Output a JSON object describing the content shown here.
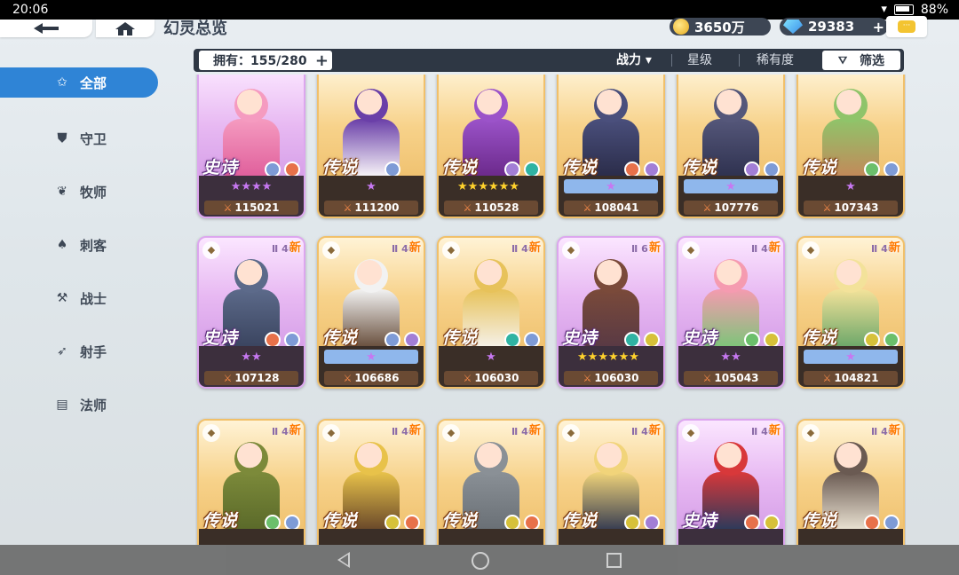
{
  "status_bar": {
    "time": "20:06",
    "battery": "88%"
  },
  "header": {
    "title": "幻灵总览",
    "gold": "3650万",
    "gems": "29383",
    "gem_plus": "+"
  },
  "sidebar": {
    "items": [
      {
        "label": "全部",
        "icon": "star-outline-icon"
      },
      {
        "label": "守卫",
        "icon": "shield-icon"
      },
      {
        "label": "牧师",
        "icon": "wings-icon"
      },
      {
        "label": "刺客",
        "icon": "hood-icon"
      },
      {
        "label": "战士",
        "icon": "axe-icon"
      },
      {
        "label": "射手",
        "icon": "bow-icon"
      },
      {
        "label": "法师",
        "icon": "book-icon"
      }
    ]
  },
  "toolbar": {
    "owned": "拥有：155/280",
    "sort_power": "战力 ▾",
    "sort_star": "星级",
    "sort_rarity": "稀有度",
    "filter": "筛选"
  },
  "cards": [
    {
      "rarity": "史诗",
      "type": "epic",
      "stars": "★★★★",
      "star_style": "purple",
      "power": "115021",
      "is_new": false,
      "level": "",
      "c1": "#f59bc0",
      "c2": "#e0609c",
      "elem1": "#7e9bd6",
      "elem2": "#e7714a"
    },
    {
      "rarity": "传说",
      "type": "legend",
      "stars": "★",
      "star_style": "purple",
      "power": "111200",
      "is_new": false,
      "level": "",
      "c1": "#6a3fa8",
      "c2": "#f6f2f7",
      "elem1": "#7e9bd6",
      "elem2": ""
    },
    {
      "rarity": "传说",
      "type": "legend",
      "stars": "★★★★★★",
      "star_style": "gold",
      "power": "110528",
      "is_new": false,
      "level": "",
      "c1": "#9b53c9",
      "c2": "#6c2a8c",
      "elem1": "#a27ed6",
      "elem2": "#2fb3a3"
    },
    {
      "rarity": "传说",
      "type": "legend",
      "stars": "★",
      "star_style": "blue-bar",
      "power": "108041",
      "is_new": false,
      "level": "",
      "c1": "#4a4f7c",
      "c2": "#2b2d4a",
      "elem1": "#e7714a",
      "elem2": "#a27ed6"
    },
    {
      "rarity": "传说",
      "type": "legend",
      "stars": "★",
      "star_style": "blue-bar",
      "power": "107776",
      "is_new": false,
      "level": "",
      "c1": "#55577a",
      "c2": "#2f3250",
      "elem1": "#a27ed6",
      "elem2": "#7e9bd6"
    },
    {
      "rarity": "传说",
      "type": "legend",
      "stars": "★",
      "star_style": "purple",
      "power": "107343",
      "is_new": false,
      "level": "",
      "c1": "#8fc46a",
      "c2": "#c28a5a",
      "elem1": "#6bbf6b",
      "elem2": "#7e9bd6"
    },
    {
      "rarity": "史诗",
      "type": "epic",
      "stars": "★★",
      "star_style": "purple",
      "power": "107128",
      "is_new": true,
      "level": "46",
      "c1": "#5c6a8a",
      "c2": "#3b4560",
      "elem1": "#e7714a",
      "elem2": "#7e9bd6"
    },
    {
      "rarity": "传说",
      "type": "legend",
      "stars": "★",
      "star_style": "blue-bar",
      "power": "106686",
      "is_new": true,
      "level": "46",
      "c1": "#f2f2f2",
      "c2": "#6b5240",
      "elem1": "#7e9bd6",
      "elem2": "#a27ed6"
    },
    {
      "rarity": "传说",
      "type": "legend",
      "stars": "★",
      "star_style": "purple",
      "power": "106030",
      "is_new": true,
      "level": "46",
      "c1": "#e7c25a",
      "c2": "#f5f0e6",
      "elem1": "#2fb3a3",
      "elem2": "#7e9bd6"
    },
    {
      "rarity": "史诗",
      "type": "epic",
      "stars": "★★★★★★",
      "star_style": "gold",
      "power": "106030",
      "is_new": true,
      "level": "6",
      "c1": "#7a4a3a",
      "c2": "#5a3a44",
      "elem1": "#2fb3a3",
      "elem2": "#d6c13a"
    },
    {
      "rarity": "史诗",
      "type": "epic",
      "stars": "★★",
      "star_style": "purple",
      "power": "105043",
      "is_new": true,
      "level": "46",
      "c1": "#f59bb0",
      "c2": "#7fc47a",
      "elem1": "#6bbf6b",
      "elem2": "#d6c13a"
    },
    {
      "rarity": "传说",
      "type": "legend",
      "stars": "★",
      "star_style": "blue-bar",
      "power": "104821",
      "is_new": true,
      "level": "46",
      "c1": "#f3e29a",
      "c2": "#6ea86a",
      "elem1": "#d6c13a",
      "elem2": "#6bbf6b"
    },
    {
      "rarity": "传说",
      "type": "legend",
      "stars": "",
      "star_style": "purple",
      "power": "",
      "is_new": true,
      "level": "46",
      "c1": "#7c8a3a",
      "c2": "#5b6a2a",
      "elem1": "#6bbf6b",
      "elem2": "#7e9bd6"
    },
    {
      "rarity": "传说",
      "type": "legend",
      "stars": "",
      "star_style": "purple",
      "power": "",
      "is_new": true,
      "level": "46",
      "c1": "#e8c24a",
      "c2": "#6b4a2a",
      "elem1": "#d6c13a",
      "elem2": "#e7714a"
    },
    {
      "rarity": "传说",
      "type": "legend",
      "stars": "",
      "star_style": "purple",
      "power": "",
      "is_new": true,
      "level": "46",
      "c1": "#8a9096",
      "c2": "#6a7076",
      "elem1": "#d6c13a",
      "elem2": "#e7714a"
    },
    {
      "rarity": "传说",
      "type": "legend",
      "stars": "",
      "star_style": "purple",
      "power": "",
      "is_new": true,
      "level": "46",
      "c1": "#f1d47a",
      "c2": "#3a3f52",
      "elem1": "#d6c13a",
      "elem2": "#a27ed6"
    },
    {
      "rarity": "史诗",
      "type": "epic",
      "stars": "",
      "star_style": "purple",
      "power": "",
      "is_new": true,
      "level": "46",
      "c1": "#d8383a",
      "c2": "#2f3a5a",
      "elem1": "#e7714a",
      "elem2": "#d6c13a"
    },
    {
      "rarity": "传说",
      "type": "legend",
      "stars": "",
      "star_style": "purple",
      "power": "",
      "is_new": true,
      "level": "46",
      "c1": "#6a5a52",
      "c2": "#e8e0d0",
      "elem1": "#e7714a",
      "elem2": "#7e9bd6"
    }
  ],
  "colors": {
    "accent": "#2f84d6",
    "toolbar_bg": "#2e3744",
    "new_tag": "#ff7a00"
  },
  "new_label": "新"
}
